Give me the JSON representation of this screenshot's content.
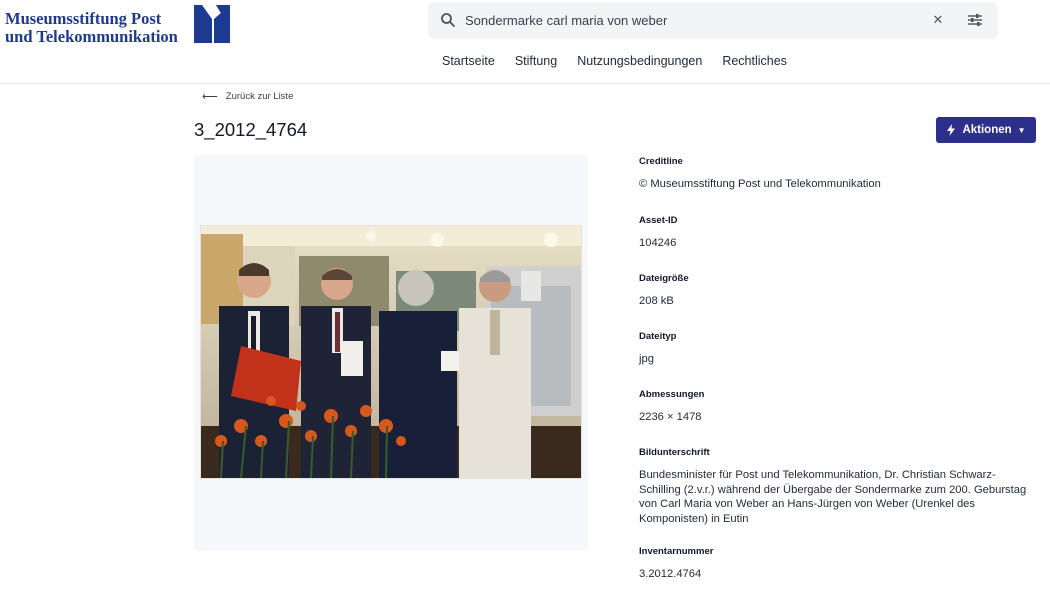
{
  "header": {
    "logo_line1": "Museumsstiftung Post",
    "logo_line2": "und Telekommunikation",
    "logo_mark_icon": "museumsstiftung-logo-mark",
    "search": {
      "value": "Sondermarke carl maria von weber",
      "icon": "search-icon",
      "clear_icon": "close-icon",
      "filter_icon": "sliders-icon"
    },
    "nav": [
      "Startseite",
      "Stiftung",
      "Nutzungsbedingungen",
      "Rechtliches"
    ]
  },
  "page": {
    "back_label": "Zurück zur Liste",
    "title": "3_2012_4764",
    "actions_label": "Aktionen",
    "actions_icon": "bolt-icon"
  },
  "metadata": [
    {
      "label": "Creditline",
      "value": "© Museumsstiftung Post und Telekommunikation"
    },
    {
      "label": "Asset-ID",
      "value": "104246"
    },
    {
      "label": "Dateigröße",
      "value": "208 kB"
    },
    {
      "label": "Dateityp",
      "value": "jpg"
    },
    {
      "label": "Abmessungen",
      "value": "2236 × 1478"
    },
    {
      "label": "Bildunterschrift",
      "value": "Bundesminister für Post und Telekommunikation, Dr. Christian Schwarz-Schilling (2.v.r.) während der Übergabe der Sondermarke zum 200. Geburstag von Carl Maria von Weber an Hans-Jürgen von Weber (Urenkel des Komponisten) in Eutin"
    },
    {
      "label": "Inventarnummer",
      "value": "3.2012.4764"
    }
  ],
  "colors": {
    "brand_blue": "#1c3a8f",
    "action_button": "#2d2f8c"
  }
}
